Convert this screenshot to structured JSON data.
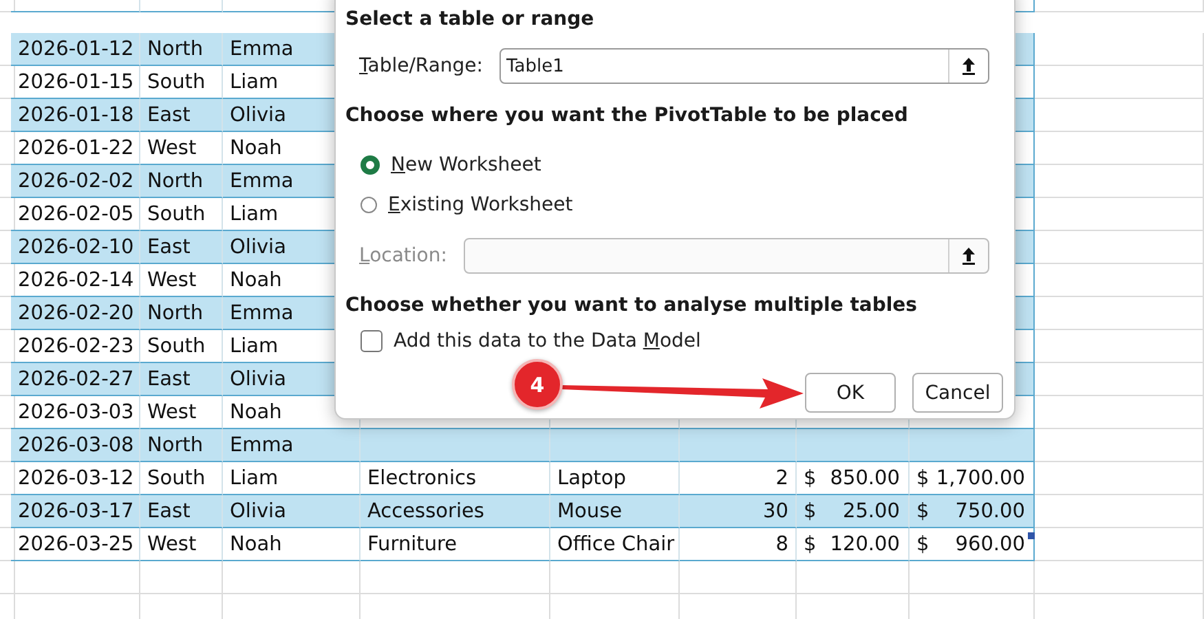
{
  "table": {
    "rows": [
      {
        "date": "2026-01-12",
        "region": "North",
        "name": "Emma"
      },
      {
        "date": "2026-01-15",
        "region": "South",
        "name": "Liam"
      },
      {
        "date": "2026-01-18",
        "region": "East",
        "name": "Olivia"
      },
      {
        "date": "2026-01-22",
        "region": "West",
        "name": "Noah"
      },
      {
        "date": "2026-02-02",
        "region": "North",
        "name": "Emma"
      },
      {
        "date": "2026-02-05",
        "region": "South",
        "name": "Liam"
      },
      {
        "date": "2026-02-10",
        "region": "East",
        "name": "Olivia"
      },
      {
        "date": "2026-02-14",
        "region": "West",
        "name": "Noah"
      },
      {
        "date": "2026-02-20",
        "region": "North",
        "name": "Emma"
      },
      {
        "date": "2026-02-23",
        "region": "South",
        "name": "Liam"
      },
      {
        "date": "2026-02-27",
        "region": "East",
        "name": "Olivia"
      },
      {
        "date": "2026-03-03",
        "region": "West",
        "name": "Noah"
      },
      {
        "date": "2026-03-08",
        "region": "North",
        "name": "Emma"
      },
      {
        "date": "2026-03-12",
        "region": "South",
        "name": "Liam",
        "category": "Electronics",
        "product": "Laptop",
        "quantity": "2",
        "price": {
          "symbol": "$",
          "amount": "850.00"
        },
        "total": {
          "symbol": "$",
          "amount": "1,700.00"
        }
      },
      {
        "date": "2026-03-17",
        "region": "East",
        "name": "Olivia",
        "category": "Accessories",
        "product": "Mouse",
        "quantity": "30",
        "price": {
          "symbol": "$",
          "amount": "25.00"
        },
        "total": {
          "symbol": "$",
          "amount": "750.00"
        }
      },
      {
        "date": "2026-03-25",
        "region": "West",
        "name": "Noah",
        "category": "Furniture",
        "product": "Office Chair",
        "quantity": "8",
        "price": {
          "symbol": "$",
          "amount": "120.00"
        },
        "total": {
          "symbol": "$",
          "amount": "960.00"
        }
      }
    ]
  },
  "dialog": {
    "source_heading": "Select a table or range",
    "range_field": {
      "label": {
        "key": "T",
        "after": "able/Range:"
      },
      "value": "Table1"
    },
    "placement_heading": "Choose where you want the PivotTable to be placed",
    "placement_options": [
      {
        "label": {
          "key": "N",
          "after": "ew Worksheet"
        },
        "selected": true
      },
      {
        "label": {
          "key": "E",
          "after": "xisting Worksheet"
        },
        "selected": false
      }
    ],
    "location_field": {
      "label": {
        "key": "L",
        "after": "ocation:"
      },
      "disabled": true
    },
    "model_heading": "Choose whether you want to analyse multiple tables",
    "model_checkbox": {
      "label": {
        "before": "Add this data to the Data ",
        "key": "M",
        "after": "odel"
      },
      "checked": false
    },
    "buttons": [
      "OK",
      "Cancel"
    ]
  },
  "callout": {
    "number": "4"
  }
}
